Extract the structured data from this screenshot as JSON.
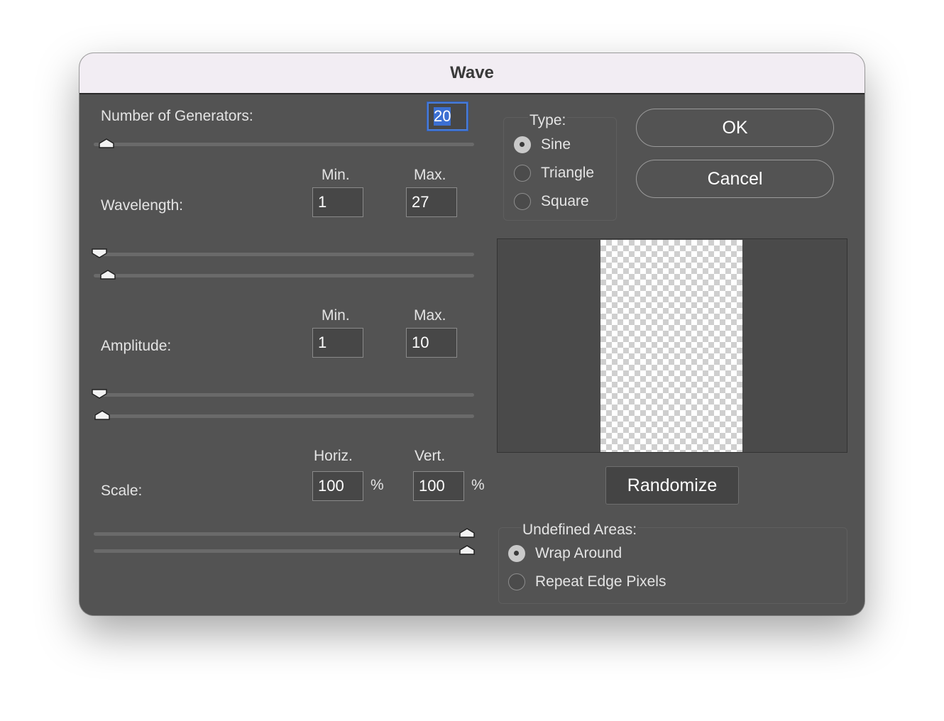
{
  "dialog": {
    "title": "Wave"
  },
  "generators": {
    "label": "Number of Generators:",
    "value": "20",
    "slider_fraction": 0.02
  },
  "wavelength": {
    "label": "Wavelength:",
    "min_label": "Min.",
    "max_label": "Max.",
    "min_value": "1",
    "max_value": "27",
    "top_slider_fraction": 0.0,
    "bottom_slider_fraction": 0.03
  },
  "amplitude": {
    "label": "Amplitude:",
    "min_label": "Min.",
    "max_label": "Max.",
    "min_value": "1",
    "max_value": "10",
    "top_slider_fraction": 0.0,
    "bottom_slider_fraction": 0.01
  },
  "scale": {
    "label": "Scale:",
    "horiz_label": "Horiz.",
    "vert_label": "Vert.",
    "horiz_value": "100",
    "vert_value": "100",
    "unit": "%",
    "horiz_slider_fraction": 1.0,
    "vert_slider_fraction": 1.0
  },
  "type": {
    "label": "Type:",
    "options": [
      "Sine",
      "Triangle",
      "Square"
    ],
    "selected": "Sine"
  },
  "buttons": {
    "ok": "OK",
    "cancel": "Cancel",
    "randomize": "Randomize"
  },
  "undefined_areas": {
    "label": "Undefined Areas:",
    "options": [
      "Wrap Around",
      "Repeat Edge Pixels"
    ],
    "selected": "Wrap Around"
  },
  "colors": {
    "dialog_bg": "#535353",
    "focus_ring": "#4a7cd6",
    "titlebar_bg": "#f2edf3"
  }
}
